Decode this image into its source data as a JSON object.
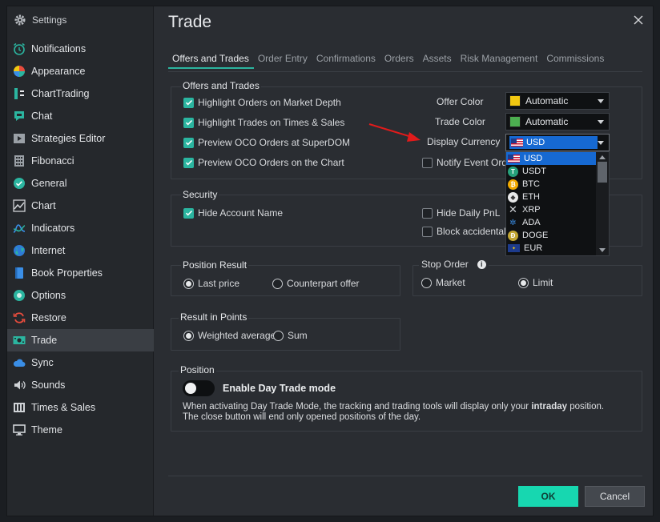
{
  "sidebar": {
    "header": "Settings",
    "items": [
      {
        "label": "Notifications",
        "icon": "alarm-clock-icon"
      },
      {
        "label": "Appearance",
        "icon": "palette-icon"
      },
      {
        "label": "ChartTrading",
        "icon": "chart-trading-icon"
      },
      {
        "label": "Chat",
        "icon": "chat-icon"
      },
      {
        "label": "Strategies Editor",
        "icon": "play-icon"
      },
      {
        "label": "Fibonacci",
        "icon": "grid-icon"
      },
      {
        "label": "General",
        "icon": "check-circle-icon"
      },
      {
        "label": "Chart",
        "icon": "line-chart-icon"
      },
      {
        "label": "Indicators",
        "icon": "indicator-icon"
      },
      {
        "label": "Internet",
        "icon": "globe-icon"
      },
      {
        "label": "Book Properties",
        "icon": "book-icon"
      },
      {
        "label": "Options",
        "icon": "options-icon"
      },
      {
        "label": "Restore",
        "icon": "restore-icon"
      },
      {
        "label": "Trade",
        "icon": "trade-icon"
      },
      {
        "label": "Sync",
        "icon": "cloud-icon"
      },
      {
        "label": "Sounds",
        "icon": "speaker-icon"
      },
      {
        "label": "Times & Sales",
        "icon": "times-sales-icon"
      },
      {
        "label": "Theme",
        "icon": "monitor-icon"
      }
    ],
    "active": "Trade"
  },
  "main": {
    "title": "Trade",
    "tabs": [
      "Offers and Trades",
      "Order Entry",
      "Confirmations",
      "Orders",
      "Assets",
      "Risk Management",
      "Commissions"
    ],
    "offers_group": {
      "label": "Offers and Trades",
      "checks": [
        {
          "label": "Highlight Orders on Market Depth",
          "checked": true
        },
        {
          "label": "Highlight Trades on Times & Sales",
          "checked": true
        },
        {
          "label": "Preview OCO Orders at SuperDOM",
          "checked": true
        },
        {
          "label": "Preview OCO Orders on the Chart",
          "checked": true
        }
      ],
      "offer_color_label": "Offer Color",
      "offer_color_value": "Automatic",
      "offer_color_swatch": "#f2c811",
      "trade_color_label": "Trade Color",
      "trade_color_value": "Automatic",
      "trade_color_swatch": "#4caf50",
      "display_currency_label": "Display Currency",
      "display_currency_value": "USD",
      "notify_label": "Notify Event Orde",
      "notify_checked": false
    },
    "currency_options": [
      {
        "code": "USD",
        "icon": "us-flag-icon"
      },
      {
        "code": "USDT",
        "icon": "tether-icon"
      },
      {
        "code": "BTC",
        "icon": "bitcoin-icon"
      },
      {
        "code": "ETH",
        "icon": "ethereum-icon"
      },
      {
        "code": "XRP",
        "icon": "xrp-icon"
      },
      {
        "code": "ADA",
        "icon": "cardano-icon"
      },
      {
        "code": "DOGE",
        "icon": "dogecoin-icon"
      },
      {
        "code": "EUR",
        "icon": "eu-flag-icon"
      }
    ],
    "security_group": {
      "label": "Security",
      "hide_account": "Hide Account Name",
      "hide_account_checked": true,
      "hide_daily": "Hide Daily PnL",
      "hide_daily_checked": false,
      "block_accidental": "Block accidental or",
      "block_checked": false
    },
    "position_result": {
      "label": "Position Result",
      "options": [
        "Last price",
        "Counterpart offer"
      ],
      "selected": "Last price"
    },
    "stop_order": {
      "label": "Stop Order",
      "options": [
        "Market",
        "Limit"
      ],
      "selected": "Limit"
    },
    "result_points": {
      "label": "Result in Points",
      "options": [
        "Weighted average",
        "Sum"
      ],
      "selected": "Weighted average"
    },
    "position": {
      "label": "Position",
      "toggle_label": "Enable Day Trade mode",
      "toggle_on": false,
      "desc_1a": "When activating Day Trade Mode, the tracking and trading tools will display only your ",
      "desc_1b": "intraday",
      "desc_1c": " position.",
      "desc_2": "The close button will end only opened positions of the day."
    },
    "ok_label": "OK",
    "cancel_label": "Cancel"
  },
  "colors": {
    "accent": "#2bb5a0",
    "ok_button": "#17d7b0",
    "selection": "#1669d2",
    "annotation_arrow": "#e01b1b"
  }
}
